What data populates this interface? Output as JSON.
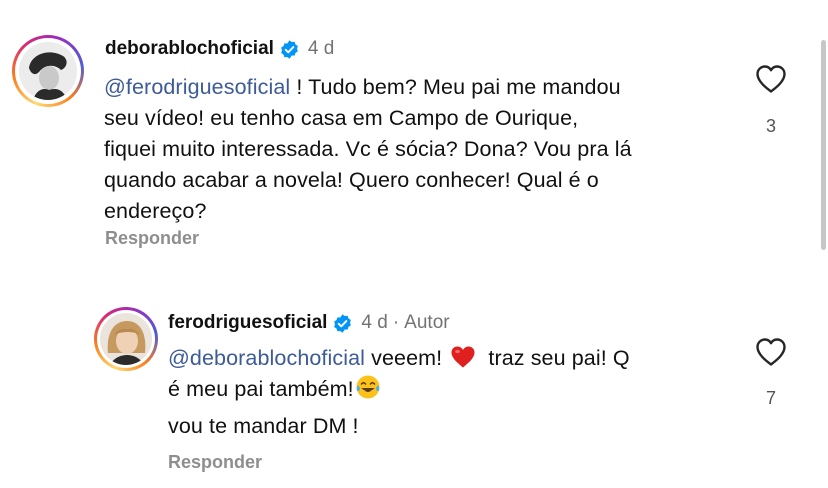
{
  "comments": [
    {
      "username": "deborablochoficial",
      "time": "4 d",
      "mention": "@ferodriguesoficial",
      "text_lines": [
        " ! Tudo bem? Meu pai me mandou",
        "seu vídeo! eu tenho casa em Campo de Ourique,",
        "fiquei muito interessada. Vc é sócia? Dona? Vou pra lá",
        "quando acabar a novela! Quero conhecer! Qual é o",
        "endereço?"
      ],
      "reply_label": "Responder",
      "likes": "3",
      "verified_icon": "verified-badge-icon",
      "like_icon": "heart-outline-icon"
    },
    {
      "username": "ferodriguesoficial",
      "time": "4 d",
      "separator": "·",
      "author_label": "Autor",
      "mention": "@deborablochoficial",
      "text_part1": " veeem! ",
      "text_part2": " traz seu pai! Q",
      "text_line2": "é meu pai também!",
      "text_line3": "vou te mandar DM !",
      "reply_label": "Responder",
      "likes": "7",
      "verified_icon": "verified-badge-icon",
      "like_icon": "heart-outline-icon",
      "emojis": [
        "red-heart-emoji",
        "tears-of-joy-emoji"
      ]
    }
  ],
  "colors": {
    "text": "#111111",
    "meta": "#737373",
    "mention": "#3d5a99",
    "verified": "#0095f6",
    "reply": "#8e8e8e"
  }
}
